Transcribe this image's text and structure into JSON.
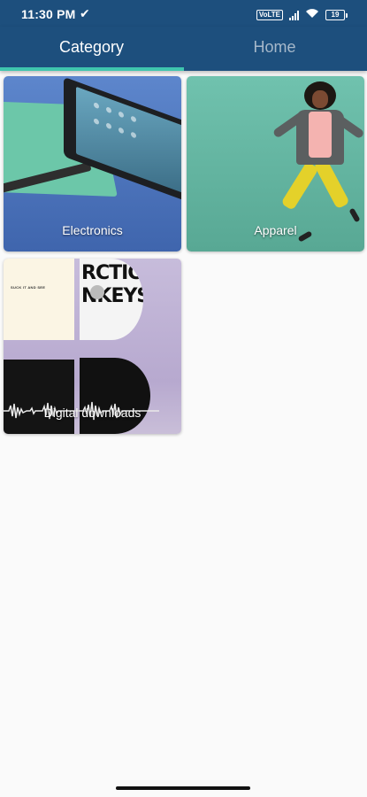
{
  "status_bar": {
    "time": "11:30 PM",
    "check_icon": "✔",
    "volte": "VoLTE",
    "battery": "19"
  },
  "tabs": [
    {
      "label": "Category",
      "selected": true
    },
    {
      "label": "Home",
      "selected": false
    }
  ],
  "colors": {
    "app_bar": "#1d4f7d",
    "indicator": "#3fc6ae",
    "background": "#fafafa"
  },
  "categories": [
    {
      "label": "Electronics"
    },
    {
      "label": "Apparel"
    },
    {
      "label": "Digital downloads"
    }
  ],
  "artwork": {
    "album_text": "SUCK IT AND SEE",
    "vinyl_lines": [
      "RCTIC",
      "NKEYS"
    ]
  }
}
